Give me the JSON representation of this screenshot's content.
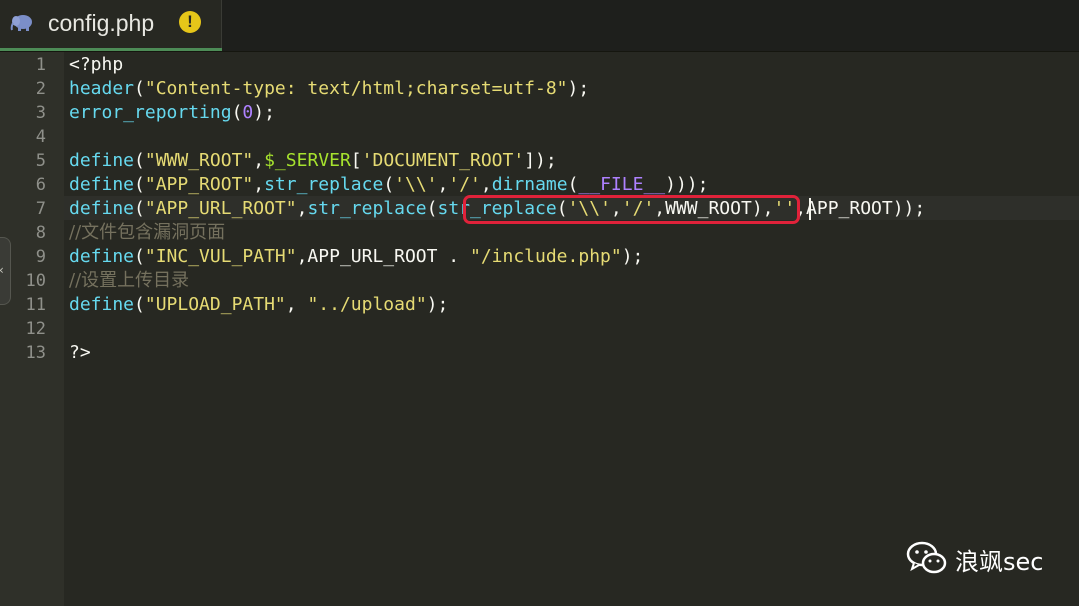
{
  "tab": {
    "filename": "config.php",
    "file_type_icon": "php-elephant-icon",
    "status_icon": "warning-icon",
    "status_glyph": "!"
  },
  "colors": {
    "background": "#272822",
    "gutter": "#2f3029",
    "function": "#66d9ef",
    "string": "#e6db74",
    "number": "#ae81ff",
    "comment": "#75715e",
    "highlight_box": "#e0223a"
  },
  "editor": {
    "active_line": 7,
    "lines": [
      {
        "number": "1",
        "tokens": [
          {
            "text": "<?php",
            "type": "plain"
          }
        ]
      },
      {
        "number": "2",
        "tokens": [
          {
            "text": "header",
            "type": "fn"
          },
          {
            "text": "(",
            "type": "plain"
          },
          {
            "text": "\"Content-type: text/html;charset=utf-8\"",
            "type": "str"
          },
          {
            "text": ");",
            "type": "plain"
          }
        ]
      },
      {
        "number": "3",
        "tokens": [
          {
            "text": "error_reporting",
            "type": "fn"
          },
          {
            "text": "(",
            "type": "plain"
          },
          {
            "text": "0",
            "type": "num"
          },
          {
            "text": ");",
            "type": "plain"
          }
        ]
      },
      {
        "number": "4",
        "tokens": []
      },
      {
        "number": "5",
        "tokens": [
          {
            "text": "define",
            "type": "fn"
          },
          {
            "text": "(",
            "type": "plain"
          },
          {
            "text": "\"WWW_ROOT\"",
            "type": "str"
          },
          {
            "text": ",",
            "type": "plain"
          },
          {
            "text": "$_SERVER",
            "type": "var"
          },
          {
            "text": "[",
            "type": "plain"
          },
          {
            "text": "'DOCUMENT_ROOT'",
            "type": "str"
          },
          {
            "text": "]);",
            "type": "plain"
          }
        ]
      },
      {
        "number": "6",
        "tokens": [
          {
            "text": "define",
            "type": "fn"
          },
          {
            "text": "(",
            "type": "plain"
          },
          {
            "text": "\"APP_ROOT\"",
            "type": "str"
          },
          {
            "text": ",",
            "type": "plain"
          },
          {
            "text": "str_replace",
            "type": "fn"
          },
          {
            "text": "(",
            "type": "plain"
          },
          {
            "text": "'\\\\'",
            "type": "str"
          },
          {
            "text": ",",
            "type": "plain"
          },
          {
            "text": "'/'",
            "type": "str"
          },
          {
            "text": ",",
            "type": "plain"
          },
          {
            "text": "dirname",
            "type": "fn"
          },
          {
            "text": "(",
            "type": "plain"
          },
          {
            "text": "__FILE__",
            "type": "const"
          },
          {
            "text": ")));",
            "type": "plain"
          }
        ]
      },
      {
        "number": "7",
        "tokens": [
          {
            "text": "define",
            "type": "fn"
          },
          {
            "text": "(",
            "type": "plain"
          },
          {
            "text": "\"APP_URL_ROOT\"",
            "type": "str"
          },
          {
            "text": ",",
            "type": "plain"
          },
          {
            "text": "str_replace",
            "type": "fn"
          },
          {
            "text": "(",
            "type": "plain"
          },
          {
            "text": "str_replace",
            "type": "fn"
          },
          {
            "text": "(",
            "type": "plain"
          },
          {
            "text": "'\\\\'",
            "type": "str"
          },
          {
            "text": ",",
            "type": "plain"
          },
          {
            "text": "'/'",
            "type": "str"
          },
          {
            "text": ",WWW_ROOT)",
            "type": "plain"
          },
          {
            "text": ",",
            "type": "plain"
          },
          {
            "text": "''",
            "type": "str"
          },
          {
            "text": ",APP_ROOT));",
            "type": "plain"
          }
        ]
      },
      {
        "number": "8",
        "tokens": [
          {
            "text": "//文件包含漏洞页面",
            "type": "cmt"
          }
        ]
      },
      {
        "number": "9",
        "tokens": [
          {
            "text": "define",
            "type": "fn"
          },
          {
            "text": "(",
            "type": "plain"
          },
          {
            "text": "\"INC_VUL_PATH\"",
            "type": "str"
          },
          {
            "text": ",APP_URL_ROOT . ",
            "type": "plain"
          },
          {
            "text": "\"/include.php\"",
            "type": "str"
          },
          {
            "text": ");",
            "type": "plain"
          }
        ]
      },
      {
        "number": "10",
        "tokens": [
          {
            "text": "//设置上传目录",
            "type": "cmt"
          }
        ]
      },
      {
        "number": "11",
        "tokens": [
          {
            "text": "define",
            "type": "fn"
          },
          {
            "text": "(",
            "type": "plain"
          },
          {
            "text": "\"UPLOAD_PATH\"",
            "type": "str"
          },
          {
            "text": ", ",
            "type": "plain"
          },
          {
            "text": "\"../upload\"",
            "type": "str"
          },
          {
            "text": ");",
            "type": "plain"
          }
        ]
      },
      {
        "number": "12",
        "tokens": []
      },
      {
        "number": "13",
        "tokens": [
          {
            "text": "?>",
            "type": "plain"
          }
        ]
      }
    ]
  },
  "fold_handle": {
    "glyph": "‹",
    "icon": "collapse-arrow-icon"
  },
  "watermark": {
    "icon": "wechat-icon",
    "text": "浪飒sec"
  }
}
